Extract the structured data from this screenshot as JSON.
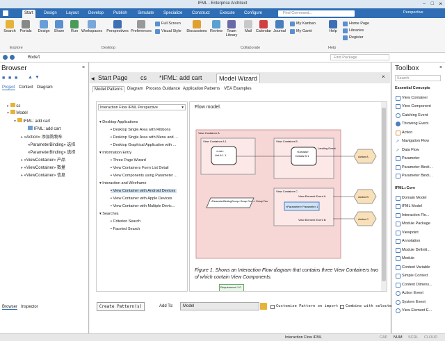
{
  "window": {
    "title": "IFML - Enterprise Architect"
  },
  "ribbon": {
    "tabs": [
      "Start",
      "Design",
      "Layout",
      "Develop",
      "Publish",
      "Simulate",
      "Specialize",
      "Construct",
      "Execute",
      "Configure"
    ],
    "search_placeholder": "Find Command...",
    "perspective": "Perspective",
    "buttons": {
      "search": "Search",
      "portals": "Portals",
      "design": "Design",
      "share": "Share",
      "run": "Run",
      "workspaces": "Workspaces",
      "perspectives": "Perspectives",
      "preferences": "Preferences",
      "full_screen": "Full Screen",
      "visual_style": "Visual Style",
      "discussions": "Discussions",
      "review": "Review",
      "team_library": "Team Library",
      "mail": "Mail",
      "calendar": "Calendar",
      "journal": "Journal",
      "my_kanban": "My Kanban",
      "my_gantt": "My Gantt",
      "help": "Help",
      "home_page": "Home Page",
      "libraries": "Libraries",
      "register": "Register"
    },
    "groups": {
      "explore": "Explore",
      "desktop": "Desktop",
      "collaborate": "Collaborate",
      "help": "Help"
    }
  },
  "address": {
    "path": "Model",
    "find_placeholder": "Find Package"
  },
  "browser": {
    "title": "Browser",
    "tabs": [
      "Project",
      "Context",
      "Diagram"
    ],
    "tree": [
      "cs",
      "Model",
      "IFML: add cart",
      "IFML: add cart",
      "«Action» 添加购物车",
      "«ParameterBinding» 选择",
      "«ParameterBinding» 选择",
      "«ViewContainer» 产品",
      "«ViewContainer» 数量",
      "«ViewContainer» 信息"
    ],
    "bottom_tabs": [
      "Browser",
      "Inspector"
    ]
  },
  "doc_tabs": [
    "Start Page",
    "cs",
    "*IFML: add cart",
    "Model Wizard"
  ],
  "wizard": {
    "tabs": [
      "Model Patterns",
      "Diagram",
      "Process Guidance",
      "Application Patterns",
      "VEA Examples"
    ],
    "perspective_select": "Interaction Flow IFML Perspective",
    "groups": [
      {
        "name": "Desktop Applications",
        "items": [
          "Desktop Single Area with Ribbons",
          "Desktop Single Area with Menu and ...",
          "Desktop Graphical Application with ..."
        ]
      },
      {
        "name": "Information Entry",
        "items": [
          "Three Page Wizard",
          "View Containers Form List Detail",
          "View Components using Parameter ..."
        ]
      },
      {
        "name": "Interaction and Wireframe",
        "items": [
          "View Container with Android Devices",
          "View Container with Apple Devices",
          "View Container with Multiple Devic..."
        ]
      },
      {
        "name": "Searches",
        "items": [
          "Criterion Search",
          "Faceted Search"
        ]
      }
    ],
    "preview_heading": "Flow model.",
    "diagram": {
      "outer": "View Container A",
      "a1": "View Container A 1",
      "a1_inner": "«List»",
      "a1_inner2": "List A 1 1",
      "b": "View Container B",
      "details": "«Details»",
      "details2": "Details B 1",
      "landing": "Landing Event",
      "action_a": "Action A",
      "c": "View Container C",
      "elem_a": "View Element Event A",
      "param": "«Parameter» Parameter 1",
      "elem_b": "View Element Event B",
      "action_b": "Action B",
      "action_c": "Action C",
      "group": "«ParameterBindingGroup» Group One -> Group Two",
      "req": "Requirement 1.0"
    },
    "caption": "Figure 1. Shows an Interaction Flow diagram that contains three View Containers two of which contain View Components.",
    "create_button": "Create Pattern(s)",
    "add_to_label": "Add To:",
    "add_to_value": "Model",
    "customize_label": "Customize Pattern on import",
    "combine_label": "Combine with selected"
  },
  "toolbox": {
    "title": "Toolbox",
    "search_placeholder": "Search",
    "section1": "Essential Concepts",
    "items1": [
      "View Container",
      "View Component",
      "Catching Event",
      "Throwing Event",
      "Action",
      "Navigation Flow",
      "Data Flow",
      "Parameter",
      "Parameter Bindi...",
      "Parameter Bindi..."
    ],
    "section2": "IFML::Core",
    "items2": [
      "Domain Model",
      "IFML Model",
      "Interaction Flo...",
      "Module Package",
      "Viewpoint",
      "Annotation",
      "Module Definiti...",
      "Module",
      "Context Variable",
      "Simple Context",
      "Context Dimens...",
      "Action Event",
      "System Event",
      "View Element E..."
    ]
  },
  "status": {
    "text": "Interaction Flow IFML",
    "cap": "CAP",
    "num": "NUM",
    "scrl": "SCRL",
    "cloud": "CLOUD"
  }
}
